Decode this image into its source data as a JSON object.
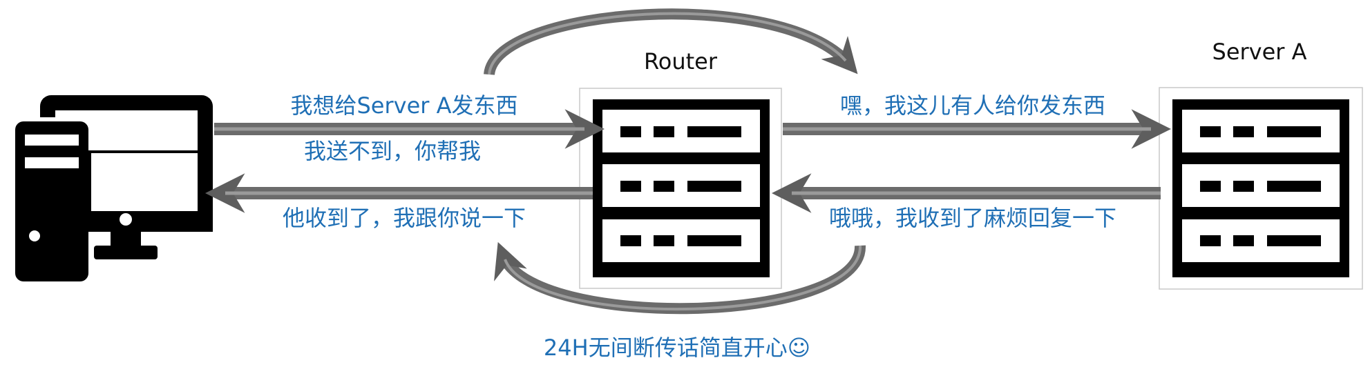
{
  "nodes": {
    "router": {
      "label": "Router"
    },
    "server": {
      "label": "Server A"
    }
  },
  "messages": {
    "pc_to_router_line1": "我想给Server A发东西",
    "pc_to_router_line2": "我送不到，你帮我",
    "router_to_server": "嘿，我这儿有人给你发东西",
    "router_to_pc": "他收到了，我跟你说一下",
    "server_to_router": "哦哦，我收到了麻烦回复一下",
    "loop_caption": "24H无间断传话简直开心☺"
  },
  "icons": [
    "desktop-computer-icon",
    "router-icon",
    "server-icon"
  ],
  "colors": {
    "text_blue": "#1f6fb5",
    "arrow_gray": "#6b6b6b",
    "icon_black": "#000000"
  }
}
